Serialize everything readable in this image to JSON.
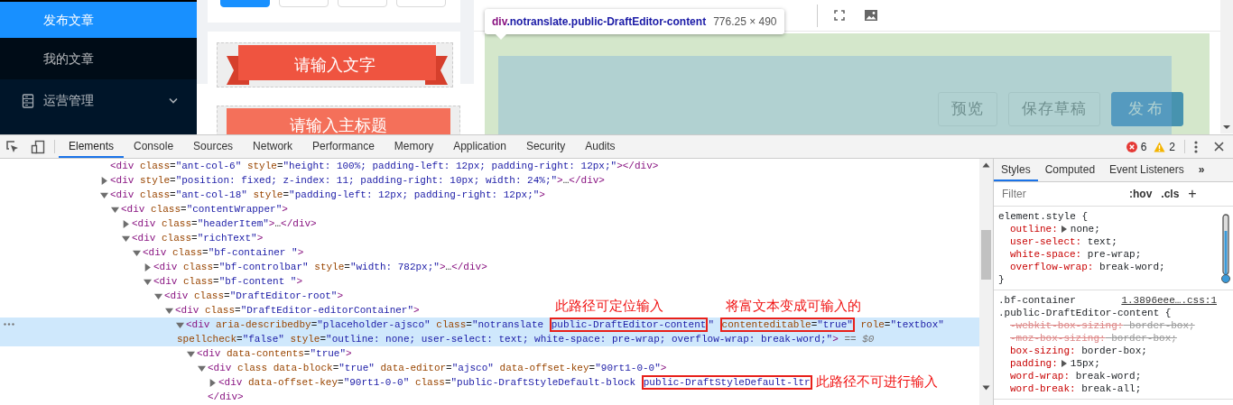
{
  "sidebar": {
    "items": [
      {
        "label": "发布文章",
        "selected": true,
        "kind": "sub"
      },
      {
        "label": "我的文章",
        "selected": false,
        "kind": "sub"
      },
      {
        "label": "运营管理",
        "selected": false,
        "kind": "group"
      }
    ]
  },
  "category_buttons": [
    {
      "selected": true
    },
    {
      "selected": false
    },
    {
      "selected": false
    },
    {
      "selected": false
    }
  ],
  "templates": [
    {
      "title": "请输入文字",
      "kind": "ribbon"
    },
    {
      "title": "请输入主标题",
      "kind": "banner"
    }
  ],
  "inspect_tooltip": {
    "tag": "div",
    "classes": ".notranslate.public-DraftEditor-content",
    "size": "776.25 × 490"
  },
  "action_buttons": [
    {
      "label": "预览",
      "kind": "default"
    },
    {
      "label": "保存草稿",
      "kind": "default"
    },
    {
      "label": "发布",
      "kind": "primary"
    }
  ],
  "devtools": {
    "tabs": [
      {
        "label": "Elements",
        "selected": true
      },
      {
        "label": "Console",
        "selected": false
      },
      {
        "label": "Sources",
        "selected": false
      },
      {
        "label": "Network",
        "selected": false
      },
      {
        "label": "Performance",
        "selected": false
      },
      {
        "label": "Memory",
        "selected": false
      },
      {
        "label": "Application",
        "selected": false
      },
      {
        "label": "Security",
        "selected": false
      },
      {
        "label": "Audits",
        "selected": false
      }
    ],
    "errors": "6",
    "warnings": "2",
    "tree": [
      {
        "kind": "leaf",
        "selected": false,
        "rows": [
          [
            {
              "text": "<div class=\"ant-col-6\" style=\"height: 100%; padding-left: 12px; padding-right: 12px;\"></div>",
              "boxed": false
            }
          ]
        ]
      },
      {
        "kind": "branch",
        "expanded": false,
        "selected": false,
        "rows": [
          [
            {
              "text": "<div style=\"position: fixed; z-index: 11; padding-right: 10px; width: 24%;\">…</div>",
              "boxed": false
            }
          ]
        ]
      },
      {
        "kind": "branch",
        "expanded": true,
        "selected": false,
        "rows": [
          [
            {
              "text": "<div class=\"ant-col-18\" style=\"padding-left: 12px; padding-right: 12px;\">",
              "boxed": false
            }
          ]
        ],
        "children": [
          {
            "kind": "branch",
            "expanded": true,
            "selected": false,
            "rows": [
              [
                {
                  "text": "<div class=\"contentWrapper\">",
                  "boxed": false
                }
              ]
            ],
            "children": [
              {
                "kind": "branch",
                "expanded": false,
                "selected": false,
                "rows": [
                  [
                    {
                      "text": "<div class=\"headerItem\">…</div>",
                      "boxed": false
                    }
                  ]
                ]
              },
              {
                "kind": "branch",
                "expanded": true,
                "selected": false,
                "rows": [
                  [
                    {
                      "text": "<div class=\"richText\">",
                      "boxed": false
                    }
                  ]
                ],
                "children": [
                  {
                    "kind": "branch",
                    "expanded": true,
                    "selected": false,
                    "rows": [
                      [
                        {
                          "text": "<div class=\"bf-container \">",
                          "boxed": false
                        }
                      ]
                    ],
                    "children": [
                      {
                        "kind": "branch",
                        "expanded": false,
                        "selected": false,
                        "rows": [
                          [
                            {
                              "text": "<div class=\"bf-controlbar\" style=\"width: 782px;\">…</div>",
                              "boxed": false
                            }
                          ]
                        ]
                      },
                      {
                        "kind": "branch",
                        "expanded": true,
                        "selected": false,
                        "rows": [
                          [
                            {
                              "text": "<div class=\"bf-content \">",
                              "boxed": false
                            }
                          ]
                        ],
                        "children": [
                          {
                            "kind": "branch",
                            "expanded": true,
                            "selected": false,
                            "rows": [
                              [
                                {
                                  "text": "<div class=\"DraftEditor-root\">",
                                  "boxed": false
                                }
                              ]
                            ],
                            "children": [
                              {
                                "kind": "branch",
                                "expanded": true,
                                "selected": false,
                                "rows": [
                                  [
                                    {
                                      "text": "<div class=\"DraftEditor-editorContainer\">",
                                      "boxed": false
                                    }
                                  ]
                                ],
                                "children": [
                                  {
                                    "kind": "branch",
                                    "expanded": true,
                                    "selected": true,
                                    "console_ref": " == $0",
                                    "rows": [
                                      [
                                        {
                                          "text": "<div aria-describedby=\"placeholder-ajsco\" class=\"notranslate ",
                                          "boxed": false
                                        },
                                        {
                                          "text": "public-DraftEditor-content",
                                          "boxed": true,
                                          "note": "此路径可定位输入",
                                          "note_above": true
                                        },
                                        {
                                          "text": "\" ",
                                          "boxed": false
                                        },
                                        {
                                          "text": "contenteditable=\"true\"",
                                          "boxed": true,
                                          "note": "将富文本变成可输入的",
                                          "note_above": true
                                        },
                                        {
                                          "text": " role=\"textbox\"",
                                          "boxed": false
                                        }
                                      ],
                                      [
                                        {
                                          "text": "spellcheck=\"false\" style=\"outline: none; user-select: text; white-space: pre-wrap; overflow-wrap: break-word;\">",
                                          "boxed": false
                                        }
                                      ]
                                    ],
                                    "children": [
                                      {
                                        "kind": "branch",
                                        "expanded": true,
                                        "selected": false,
                                        "rows": [
                                          [
                                            {
                                              "text": "<div data-contents=\"true\">",
                                              "boxed": false
                                            }
                                          ]
                                        ],
                                        "children": [
                                          {
                                            "kind": "branch",
                                            "expanded": true,
                                            "selected": false,
                                            "closing": "</div>",
                                            "rows": [
                                              [
                                                {
                                                  "text": "<div class data-block=\"true\" data-editor=\"ajsco\" data-offset-key=\"90rt1-0-0\">",
                                                  "boxed": false
                                                }
                                              ]
                                            ],
                                            "children": [
                                              {
                                                "kind": "branch",
                                                "expanded": false,
                                                "selected": false,
                                                "rows": [
                                                  [
                                                    {
                                                      "text": "<div data-offset-key=\"90rt1-0-0\" class=\"public-DraftStyleDefault-block ",
                                                      "boxed": false
                                                    },
                                                    {
                                                      "text": "public-DraftStyleDefault-ltr",
                                                      "boxed": true,
                                                      "note": "此路径不可进行输入",
                                                      "note_above": false
                                                    }
                                                  ]
                                                ]
                                              }
                                            ]
                                          }
                                        ]
                                      }
                                    ]
                                  }
                                ]
                              }
                            ]
                          }
                        ]
                      }
                    ]
                  }
                ]
              }
            ]
          }
        ]
      }
    ],
    "styles": {
      "tabs": [
        {
          "label": "Styles",
          "selected": true
        },
        {
          "label": "Computed",
          "selected": false
        },
        {
          "label": "Event Listeners",
          "selected": false
        }
      ],
      "more": "»",
      "filter_placeholder": "Filter",
      "hov": ":hov",
      "cls": ".cls",
      "add": "+",
      "rules": [
        {
          "selectors": [
            "element.style {"
          ],
          "declarations": [
            {
              "property": "outline:",
              "value": "none;",
              "expandable": true,
              "overridden": false
            },
            {
              "property": "user-select:",
              "value": "text;",
              "expandable": false,
              "overridden": false
            },
            {
              "property": "white-space:",
              "value": "pre-wrap;",
              "expandable": false,
              "overridden": false
            },
            {
              "property": "overflow-wrap:",
              "value": "break-word;",
              "expandable": false,
              "overridden": false
            }
          ],
          "close": "}"
        },
        {
          "selectors": [
            ".bf-container",
            ".public-DraftEditor-content {"
          ],
          "source": "1.3896eee….css:1",
          "declarations": [
            {
              "property": "-webkit-box-sizing:",
              "value": "border-box;",
              "expandable": false,
              "overridden": true
            },
            {
              "property": "-moz-box-sizing:",
              "value": "border-box;",
              "expandable": false,
              "overridden": true
            },
            {
              "property": "box-sizing:",
              "value": "border-box;",
              "expandable": false,
              "overridden": false
            },
            {
              "property": "padding:",
              "value": "15px;",
              "expandable": true,
              "overridden": false
            },
            {
              "property": "word-wrap:",
              "value": "break-word;",
              "expandable": false,
              "overridden": false
            },
            {
              "property": "word-break:",
              "value": "break-all;",
              "expandable": false,
              "overridden": false
            }
          ]
        }
      ]
    }
  }
}
